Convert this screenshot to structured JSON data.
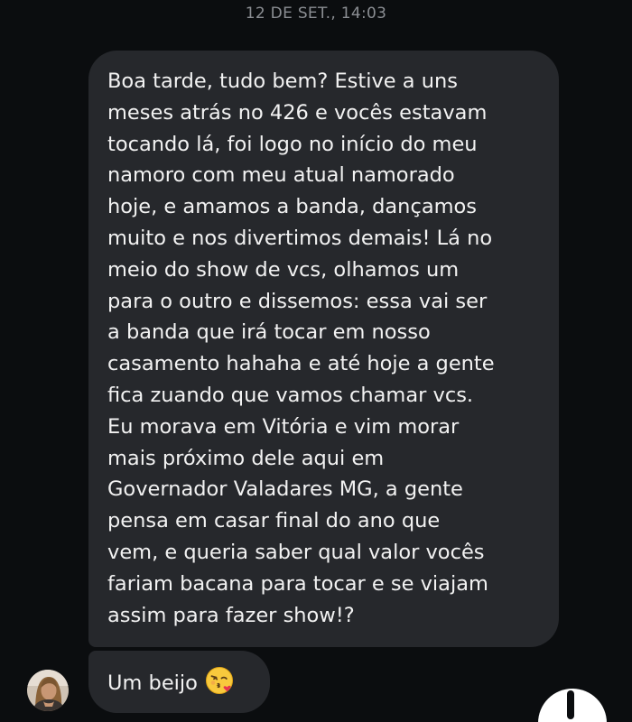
{
  "conversation": {
    "date_separator": "12 DE SET., 14:03",
    "messages": [
      {
        "lines": [
          "Boa tarde, tudo bem? Estive a uns",
          "meses atrás no 426 e vocês estavam",
          "tocando lá, foi logo no início do meu",
          "namoro com meu atual namorado",
          "hoje, e amamos a banda, dançamos",
          "muito e nos divertimos demais! Lá no",
          "meio do show de vcs, olhamos um",
          "para o outro e dissemos: essa vai ser",
          "a banda que irá tocar em nosso",
          "casamento hahaha e até hoje a gente",
          "fica zuando que vamos chamar vcs.",
          "Eu morava em Vitória e vim morar",
          "mais próximo dele aqui em",
          "Governador Valadares MG, a gente",
          "pensa em casar final do ano que",
          "vem, e queria saber qual valor vocês",
          "fariam bacana para tocar e se viajam",
          "assim para fazer show!?"
        ]
      },
      {
        "text": "Um beijo",
        "emoji": "face-blowing-a-kiss-icon"
      }
    ]
  },
  "colors": {
    "background": "#0b0d0f",
    "bubble": "#26282c",
    "text": "#f2f2f2",
    "timestamp": "#8b8e93"
  }
}
